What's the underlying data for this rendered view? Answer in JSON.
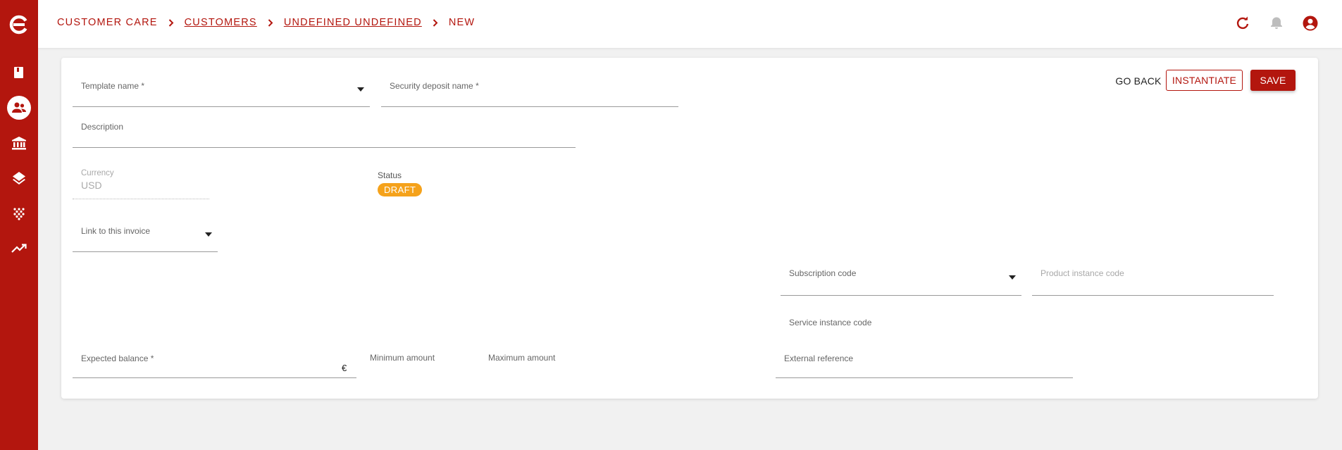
{
  "sidebar": {
    "items": [
      {
        "icon": "logo-icon"
      },
      {
        "icon": "book-icon"
      },
      {
        "icon": "customers-icon",
        "active": true
      },
      {
        "icon": "bank-icon"
      },
      {
        "icon": "layers-icon"
      },
      {
        "icon": "grid-dots-icon"
      },
      {
        "icon": "trending-up-icon"
      }
    ]
  },
  "header": {
    "breadcrumb": {
      "item1": "CUSTOMER CARE",
      "item2": "CUSTOMERS",
      "item3": "UNDEFINED UNDEFINED",
      "item4": "NEW"
    },
    "icons": [
      "refresh-icon",
      "bell-icon",
      "account-circle-icon"
    ]
  },
  "form": {
    "template_name_label": "Template name *",
    "security_deposit_name_label": "Security deposit name *",
    "description_label": "Description",
    "currency_label": "Currency",
    "currency_value": "USD",
    "status_label": "Status",
    "status_value": "DRAFT",
    "link_invoice_label": "Link to this invoice",
    "subscription_code_label": "Subscription code",
    "product_instance_code_label": "Product instance code",
    "service_instance_code_label": "Service instance code",
    "expected_balance_label": "Expected balance *",
    "expected_balance_suffix": "€",
    "minimum_amount_label": "Minimum amount",
    "maximum_amount_label": "Maximum amount",
    "external_reference_label": "External reference"
  },
  "actions": {
    "go_back": "GO BACK",
    "instantiate": "INSTANTIATE",
    "save": "SAVE"
  },
  "colors": {
    "brand": "#b3160e",
    "status_draft": "#f5a21b",
    "background": "#f1f1f1"
  }
}
